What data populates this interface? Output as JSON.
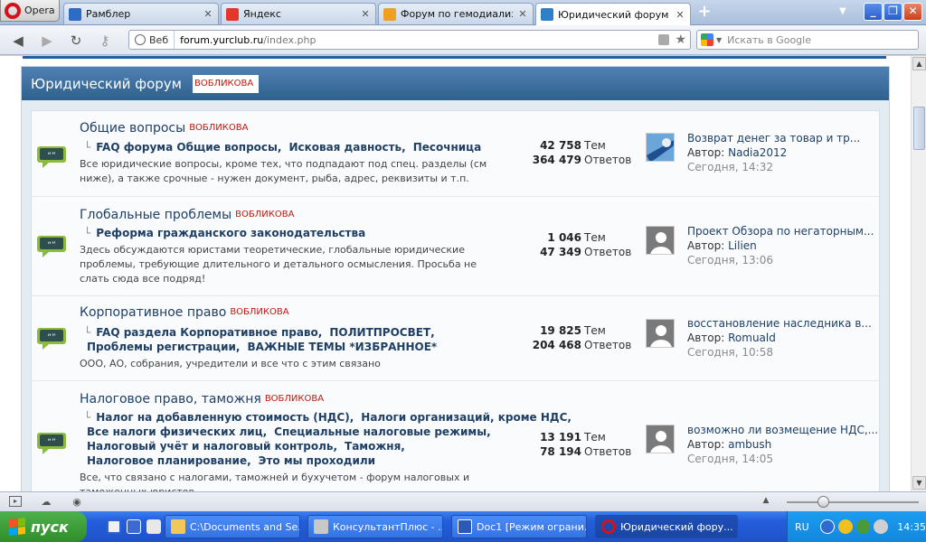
{
  "browser": {
    "menu_label": "Opera",
    "tabs": [
      {
        "title": "Рамблер",
        "icon": "rambler-icon",
        "color": "#2d6bc4"
      },
      {
        "title": "Яндекс",
        "icon": "yandex-icon",
        "color": "#e8352b"
      },
      {
        "title": "Форум по гемодиализу:...",
        "icon": "forum-icon",
        "color": "#f0a020"
      },
      {
        "title": "Юридический форум юр...",
        "icon": "yurclub-icon",
        "color": "#2f80c9"
      }
    ],
    "new_tab": "+",
    "address": {
      "scope": "Веб",
      "url_host": "forum.yurclub.ru",
      "url_path": "/index.php"
    },
    "search_placeholder": "Искать в Google"
  },
  "forum": {
    "title": "Юридический форум",
    "moderator": "ВОБЛИКОВА",
    "topics_label": "Тем",
    "replies_label": "Ответов",
    "author_prefix": "Автор:",
    "rows": [
      {
        "name": "Общие вопросы",
        "moderator": "ВОБЛИКОВА",
        "subs": [
          [
            "FAQ форума Общие вопросы,",
            "Исковая давность,",
            "Песочница"
          ]
        ],
        "desc": "Все юридические вопросы, кроме тех, что подпадают под спец. разделы (см ниже), а также срочные - нужен документ, рыба, адрес, реквизиты и т.п.",
        "topics": "42 758",
        "replies": "364 479",
        "last_title": "Возврат денег за товар и тр...",
        "last_author": "Nadia2012",
        "last_date": "Сегодня, 14:32"
      },
      {
        "name": "Глобальные проблемы",
        "moderator": "ВОБЛИКОВА",
        "subs": [
          [
            "Реформа гражданского законодательства"
          ]
        ],
        "desc": "Здесь обсуждаются юристами теоретические, глобальные юридические проблемы, требующие длительного и детального осмысления. Просьба не слать сюда все подряд!",
        "topics": "1 046",
        "replies": "47 349",
        "last_title": "Проект Обзора по негаторным...",
        "last_author": "Lilien",
        "last_date": "Сегодня, 13:06"
      },
      {
        "name": "Корпоративное право",
        "moderator": "ВОБЛИКОВА",
        "subs": [
          [
            "FAQ раздела Корпоративное право,",
            "ПОЛИТПРОСВЕТ,"
          ],
          [
            "Проблемы регистрации,",
            "ВАЖНЫЕ ТЕМЫ *ИЗБРАННОЕ*"
          ]
        ],
        "desc": "ООО, АО, собрания, учредители и все что с этим связано",
        "topics": "19 825",
        "replies": "204 468",
        "last_title": "восстановление наследника в...",
        "last_author": "Romuald",
        "last_date": "Сегодня, 10:58"
      },
      {
        "name": "Налоговое право, таможня",
        "moderator": "ВОБЛИКОВА",
        "subs": [
          [
            "Налог на добавленную стоимость (НДС),",
            "Налоги организаций, кроме НДС,"
          ],
          [
            "Все налоги физических лиц,",
            "Специальные налоговые режимы,"
          ],
          [
            "Налоговый учёт и налоговый контроль,",
            "Таможня,"
          ],
          [
            "Налоговое планирование,",
            "Это мы проходили"
          ]
        ],
        "desc": "Все, что связано с налогами, таможней и бухучетом - форум налоговых и таможенных юристов",
        "topics": "13 191",
        "replies": "78 194",
        "last_title": "возможно ли возмещение НДС,...",
        "last_author": "ambush",
        "last_date": "Сегодня, 14:05"
      }
    ]
  },
  "taskbar": {
    "start": "пуск",
    "buttons": [
      {
        "label": "C:\\Documents and Se...",
        "icon": "folder-icon",
        "color": "#f3c85b"
      },
      {
        "label": "КонсультантПлюс - ...",
        "icon": "consultant-icon",
        "color": "#c8c8c8"
      },
      {
        "label": "Doc1 [Режим ограни...",
        "icon": "word-icon",
        "color": "#2b59b8"
      },
      {
        "label": "Юридический фору...",
        "icon": "opera-icon",
        "color": "#d3131b"
      }
    ],
    "lang": "RU",
    "clock": "14:35"
  }
}
